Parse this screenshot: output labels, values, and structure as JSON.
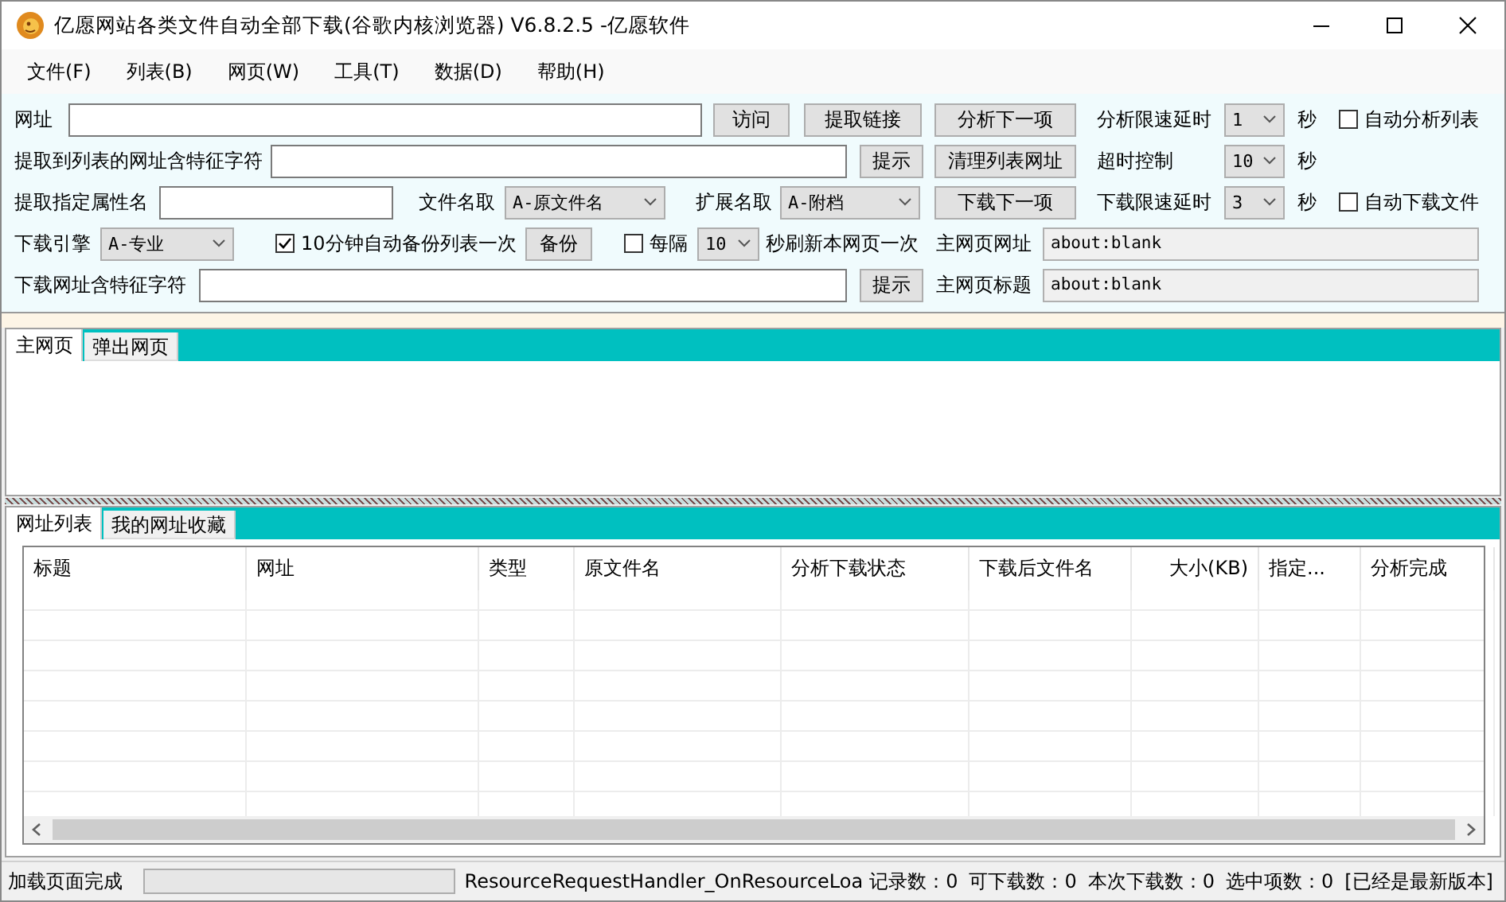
{
  "window": {
    "title": "亿愿网站各类文件自动全部下载(谷歌内核浏览器) V6.8.2.5 -亿愿软件"
  },
  "menu": [
    {
      "label": "文件(F)"
    },
    {
      "label": "列表(B)"
    },
    {
      "label": "网页(W)"
    },
    {
      "label": "工具(T)"
    },
    {
      "label": "数据(D)"
    },
    {
      "label": "帮助(H)"
    }
  ],
  "form": {
    "rows": [
      {
        "controls": [
          {
            "kind": "label",
            "text": "网址"
          },
          {
            "kind": "input"
          },
          {
            "kind": "button",
            "label": "访问"
          },
          {
            "kind": "button",
            "label": "提取链接"
          },
          {
            "kind": "button",
            "label": "分析下一项"
          },
          {
            "kind": "label",
            "text": "分析限速延时"
          },
          {
            "kind": "select",
            "value": "1"
          },
          {
            "kind": "label",
            "text": "秒"
          },
          {
            "kind": "checkbox",
            "label": "自动分析列表",
            "checked": false
          }
        ]
      },
      {
        "controls": [
          {
            "kind": "label",
            "text": "提取到列表的网址含特征字符"
          },
          {
            "kind": "input"
          },
          {
            "kind": "button",
            "label": "提示"
          },
          {
            "kind": "button",
            "label": "清理列表网址"
          },
          {
            "kind": "label",
            "text": "超时控制"
          },
          {
            "kind": "select",
            "value": "10"
          },
          {
            "kind": "label",
            "text": "秒"
          }
        ]
      },
      {
        "controls": [
          {
            "kind": "label",
            "text": "提取指定属性名"
          },
          {
            "kind": "input"
          },
          {
            "kind": "label",
            "text": "文件名取"
          },
          {
            "kind": "select",
            "value": "A-原文件名"
          },
          {
            "kind": "label",
            "text": "扩展名取"
          },
          {
            "kind": "select",
            "value": "A-附档"
          },
          {
            "kind": "button",
            "label": "下载下一项"
          },
          {
            "kind": "label",
            "text": "下载限速延时"
          },
          {
            "kind": "select",
            "value": "3"
          },
          {
            "kind": "label",
            "text": "秒"
          },
          {
            "kind": "checkbox",
            "label": "自动下载文件",
            "checked": false
          }
        ]
      },
      {
        "controls": [
          {
            "kind": "label",
            "text": "下载引擎"
          },
          {
            "kind": "select",
            "value": "A-专业"
          },
          {
            "kind": "checkbox",
            "label": "10分钟自动备份列表一次",
            "checked": true
          },
          {
            "kind": "button",
            "label": "备份"
          },
          {
            "kind": "checkbox",
            "label": "每隔",
            "checked": false
          },
          {
            "kind": "select",
            "value": "10"
          },
          {
            "kind": "label",
            "text": "秒刷新本网页一次"
          },
          {
            "kind": "label",
            "text": "主网页网址"
          },
          {
            "kind": "field",
            "value": "about:blank"
          }
        ]
      },
      {
        "controls": [
          {
            "kind": "label",
            "text": "下载网址含特征字符"
          },
          {
            "kind": "input"
          },
          {
            "kind": "button",
            "label": "提示"
          },
          {
            "kind": "label",
            "text": "主网页标题"
          },
          {
            "kind": "field",
            "value": "about:blank"
          }
        ]
      }
    ]
  },
  "browser_tabs": [
    {
      "label": "主网页",
      "selected": true
    },
    {
      "label": "弹出网页",
      "selected": false
    }
  ],
  "list_tabs": [
    {
      "label": "网址列表",
      "selected": true
    },
    {
      "label": "我的网址收藏",
      "selected": false
    }
  ],
  "table": {
    "columns": [
      {
        "label": "标题"
      },
      {
        "label": "网址"
      },
      {
        "label": "类型"
      },
      {
        "label": "原文件名"
      },
      {
        "label": "分析下载状态"
      },
      {
        "label": "下载后文件名"
      },
      {
        "label": "大小(KB)"
      },
      {
        "label": "指定..."
      },
      {
        "label": "分析完成"
      }
    ]
  },
  "status_bar": {
    "message": "加载页面完成",
    "progress": {
      "level": 0
    },
    "handler": "ResourceRequestHandler_OnResourceLoa",
    "counts": [
      "记录数：0",
      "可下载数：0",
      "本次下载数：0",
      "选中项数：0"
    ],
    "version": "[已经是最新版本]"
  }
}
